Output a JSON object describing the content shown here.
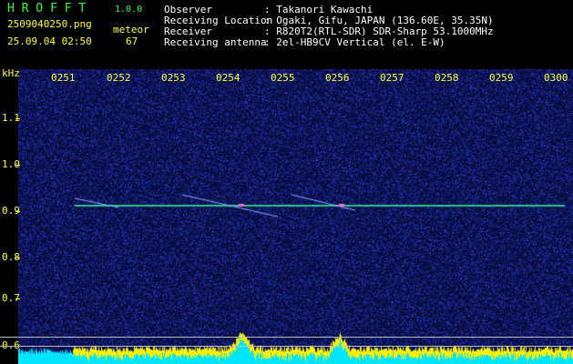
{
  "header": {
    "app_title": "H R O F F T",
    "version": "1.0.0",
    "filename": "2509040250.png",
    "datetime": "25.09.04 02:50",
    "meteor_label": "meteor",
    "meteor_count": "67",
    "fields": [
      {
        "label": "Observer",
        "value": ": Takanori Kawachi"
      },
      {
        "label": "Receiving Location",
        "value": ": Ogaki, Gifu, JAPAN (136.60E, 35.35N)"
      },
      {
        "label": "Receiver",
        "value": ": R820T2(RTL-SDR) SDR-Sharp 53.1000MHz"
      },
      {
        "label": "Receiving antenna",
        "value": ": 2el-HB9CV Vertical (el. E-W)"
      }
    ]
  },
  "axes": {
    "y_unit": "kHz",
    "y_ticks": [
      "1.1",
      "1.0",
      "0.9",
      "0.8",
      "0.7",
      "0.6"
    ],
    "x_ticks": [
      "0251",
      "0252",
      "0253",
      "0254",
      "0255",
      "0256",
      "0257",
      "0258",
      "0259",
      "0300"
    ]
  },
  "colors": {
    "label": "#ffff33",
    "title": "#33ff33",
    "background": "#0a0e3a",
    "carrier": "#33ff99",
    "meteor": "#ff66cc",
    "spectrum": "#00e5ff",
    "spectrum_peak": "#ffee00"
  }
}
